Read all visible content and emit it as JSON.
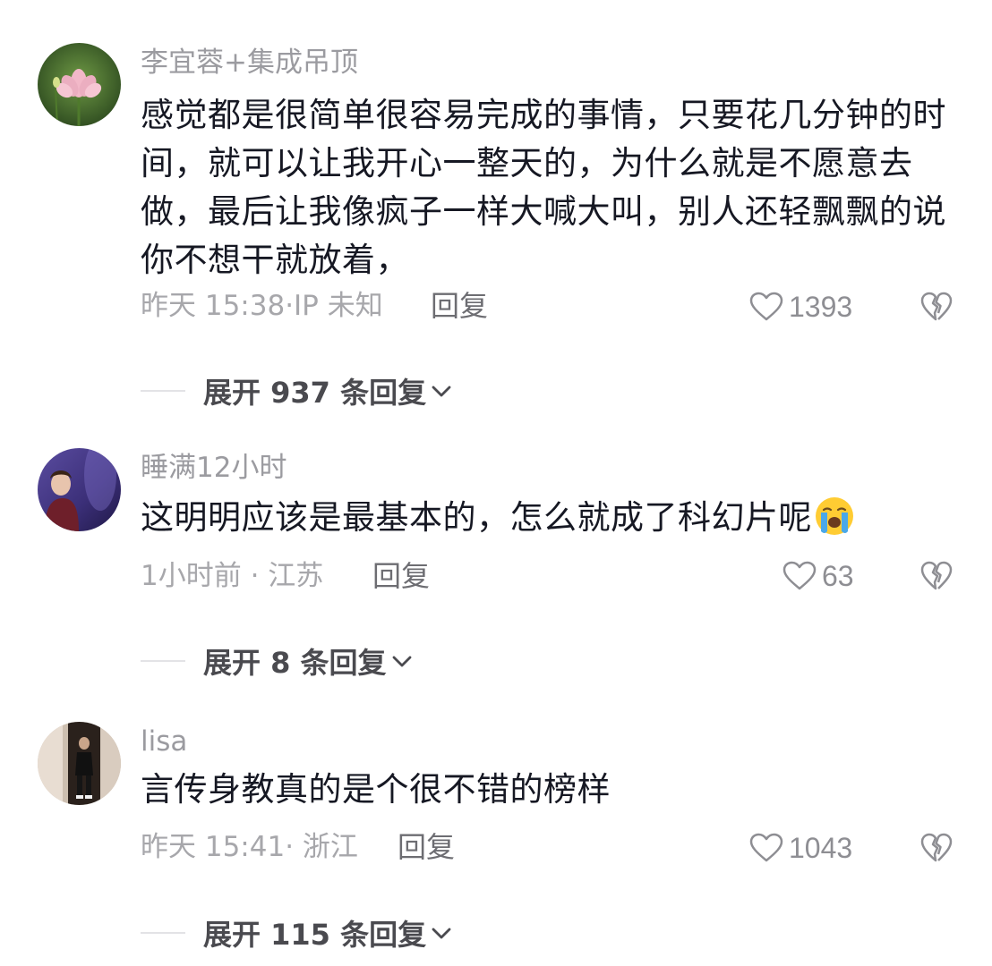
{
  "comments": [
    {
      "author": "李宜蓉+集成吊顶",
      "text": "感觉都是很简单很容易完成的事情，只要花几分钟的时间，就可以让我开心一整天的，为什么就是不愿意去做，最后让我像疯子一样大喊大叫，别人还轻飘飘的说你不想干就放着，",
      "meta": "昨天 15:38·IP 未知",
      "reply_label": "回复",
      "likes": "1393",
      "expand_label": "展开 937 条回复",
      "avatar_icon": "lotus-avatar"
    },
    {
      "author": "睡满12小时",
      "text": "这明明应该是最基本的，怎么就成了科幻片呢",
      "emoji": "crying-face-emoji",
      "meta": "1小时前 · 江苏",
      "reply_label": "回复",
      "likes": "63",
      "expand_label": "展开 8 条回复",
      "avatar_icon": "person-stage-avatar"
    },
    {
      "author": "lisa",
      "text": "言传身教真的是个很不错的榜样",
      "meta": "昨天 15:41· 浙江",
      "reply_label": "回复",
      "likes": "1043",
      "expand_label": "展开 115 条回复",
      "avatar_icon": "person-doorway-avatar"
    }
  ],
  "colors": {
    "text": "#161823",
    "secondary": "#9b9ba0",
    "icon": "#8e8e93"
  }
}
